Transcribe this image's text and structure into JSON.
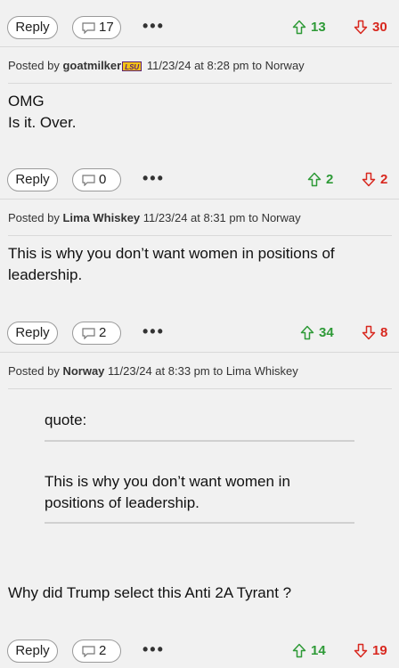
{
  "posts": [
    {
      "reply_label": "Reply",
      "comments": "17",
      "upvotes": "13",
      "downvotes": "30"
    },
    {
      "author": "goatmilker",
      "team_badge": "LSU",
      "timestamp": "11/23/24 at 8:28 pm",
      "to": "Norway",
      "body_lines": [
        "OMG",
        "Is it. Over."
      ],
      "reply_label": "Reply",
      "comments": "0",
      "upvotes": "2",
      "downvotes": "2"
    },
    {
      "author": "Lima Whiskey",
      "timestamp": "11/23/24 at 8:31 pm",
      "to": "Norway",
      "body": "This is why you don’t want women in positions of leadership.",
      "reply_label": "Reply",
      "comments": "2",
      "upvotes": "34",
      "downvotes": "8"
    },
    {
      "author": "Norway",
      "timestamp": "11/23/24 at 8:33 pm",
      "to": "Lima Whiskey",
      "quote_label": "quote:",
      "quote": "This is why you don’t want women in positions of leadership.",
      "body": "Why did Trump select this Anti 2A Tyrant ?",
      "reply_label": "Reply",
      "comments": "2",
      "upvotes": "14",
      "downvotes": "19"
    }
  ],
  "strings": {
    "posted_by": "Posted by",
    "to_word": "to",
    "more": "•••"
  },
  "icons": {
    "upvote": "up-arrow-outline-icon",
    "downvote": "down-arrow-outline-icon",
    "comment": "speech-bubble-icon",
    "more": "ellipsis-icon"
  },
  "colors": {
    "up": "#2e9a37",
    "down": "#d8281f",
    "background": "#f1f1f1"
  }
}
